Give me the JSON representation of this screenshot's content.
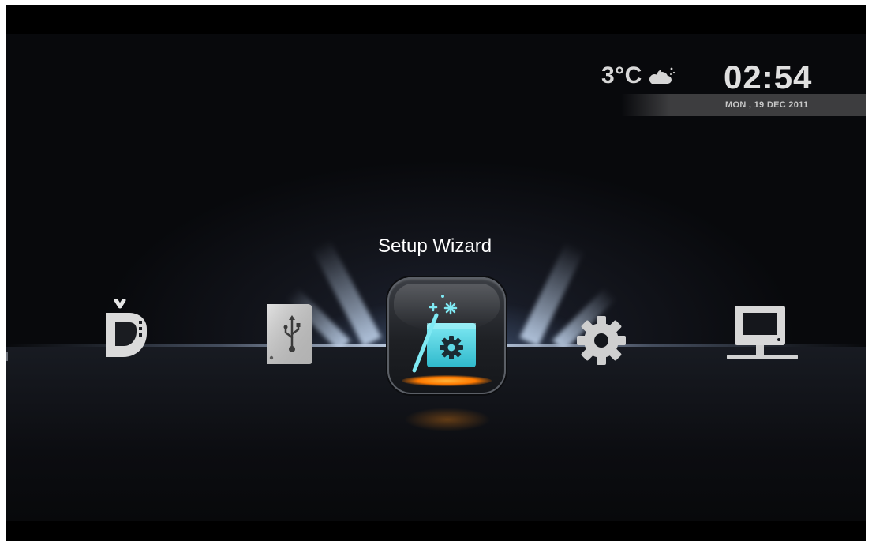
{
  "status": {
    "temperature": "3°C",
    "weather_icon": "partly-cloudy-night-icon",
    "time": "02:54",
    "date": "MON , 19 DEC 2011"
  },
  "menu": {
    "selected_label": "Setup Wizard",
    "items": [
      {
        "icon": "dlna-tv-icon"
      },
      {
        "icon": "usb-storage-icon"
      },
      {
        "icon": "setup-wizard-icon",
        "selected": true
      },
      {
        "icon": "settings-gear-icon"
      },
      {
        "icon": "network-computer-icon"
      }
    ]
  },
  "colors": {
    "background": "#000000",
    "text": "#ffffff",
    "accent_cyan": "#4fd8e8",
    "accent_orange": "#ff8c1a",
    "icon_gray": "#c9c9c9"
  }
}
